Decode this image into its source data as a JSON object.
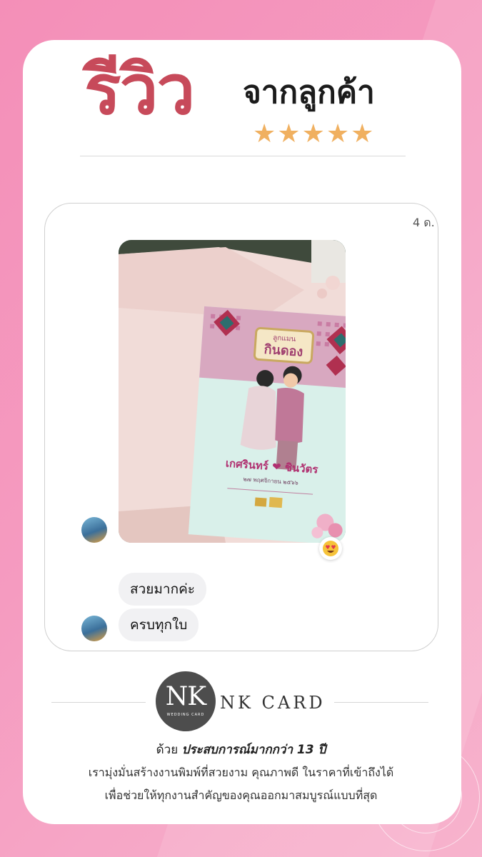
{
  "header": {
    "title_big": "รีวิว",
    "title_small": "จากลูกค้า",
    "stars": 5,
    "star_color": "#f0b060",
    "title_color": "#c74a5a"
  },
  "chat": {
    "timestamp": "4 ด.",
    "photo_card": {
      "top_label": "ลูกแมน",
      "top_title": "กินดอง",
      "names": "เกศรินทร์ ❤ ชินวัตร",
      "date_line": "๒๗ พฤศจิกายน ๒๕๖๖"
    },
    "reaction_icon": "heart-eyes-emoji",
    "messages": [
      "สวยมากค่ะ",
      "ครบทุกใบ"
    ]
  },
  "footer": {
    "logo_mark": "NK",
    "logo_sub": "WEDDING CARD",
    "brand_name": "NK CARD",
    "tagline_prefix": "ด้วย",
    "tagline_bold": "ประสบการณ์มากกว่า 13 ปี",
    "line2": "เรามุ่งมั่นสร้างงานพิมพ์ที่สวยงาม คุณภาพดี ในราคาที่เข้าถึงได้",
    "line3": "เพื่อช่วยให้ทุกงานสำคัญของคุณออกมาสมบูรณ์แบบที่สุด"
  },
  "colors": {
    "background_pink": "#f48fb8",
    "card": "#ffffff"
  }
}
